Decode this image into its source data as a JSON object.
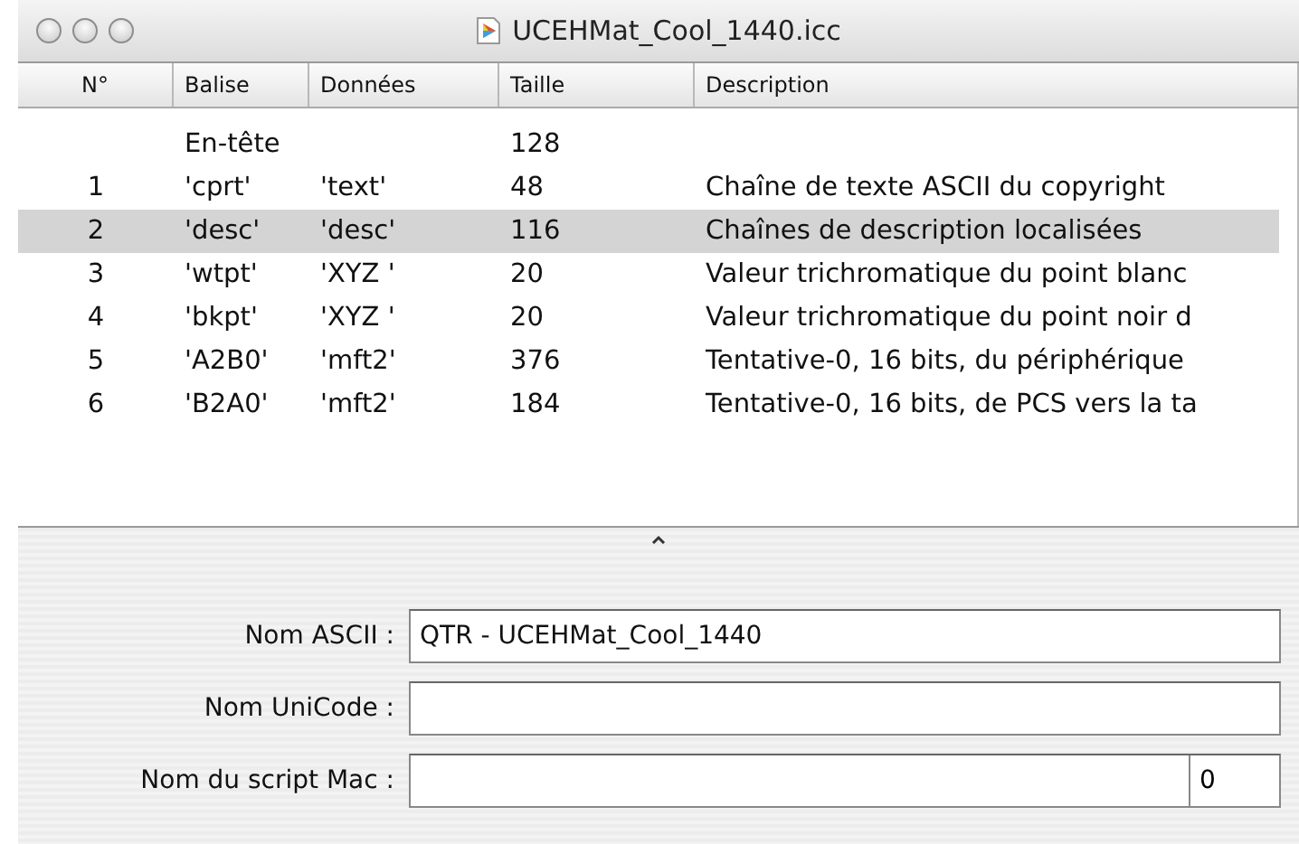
{
  "window": {
    "title": "UCEHMat_Cool_1440.icc"
  },
  "table": {
    "columns": [
      "N°",
      "Balise",
      "Données",
      "Taille",
      "Description"
    ],
    "rows": [
      {
        "tag": "En-tête",
        "size": "128",
        "selected": false
      },
      {
        "no": "1",
        "tag": "'cprt'",
        "data": "'text'",
        "size": "48",
        "description": "Chaîne de texte ASCII du copyright",
        "selected": false
      },
      {
        "no": "2",
        "tag": "'desc'",
        "data": "'desc'",
        "size": "116",
        "description": "Chaînes de description localisées",
        "selected": true
      },
      {
        "no": "3",
        "tag": "'wtpt'",
        "data": "'XYZ '",
        "size": "20",
        "description": "Valeur trichromatique du point blanc",
        "selected": false
      },
      {
        "no": "4",
        "tag": "'bkpt'",
        "data": "'XYZ '",
        "size": "20",
        "description": "Valeur trichromatique du point noir d",
        "selected": false
      },
      {
        "no": "5",
        "tag": "'A2B0'",
        "data": "'mft2'",
        "size": "376",
        "description": "Tentative-0, 16 bits, du périphérique",
        "selected": false
      },
      {
        "no": "6",
        "tag": "'B2A0'",
        "data": "'mft2'",
        "size": "184",
        "description": "Tentative-0, 16 bits, de PCS vers la ta",
        "selected": false
      }
    ]
  },
  "fields": [
    {
      "label": "Nom ASCII :",
      "value": "QTR - UCEHMat_Cool_1440"
    },
    {
      "label": "Nom UniCode :"
    },
    {
      "label": "Nom du script Mac :",
      "code": "0"
    }
  ]
}
